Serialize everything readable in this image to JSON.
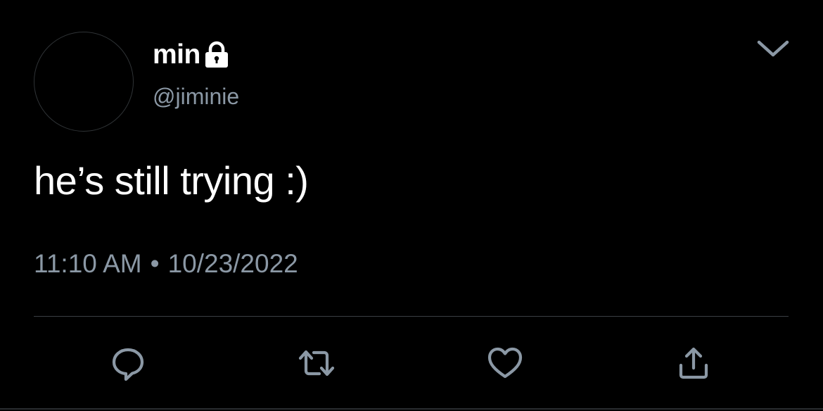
{
  "tweet": {
    "display_name": "min",
    "handle": "@jiminie",
    "text": "he’s still trying :)",
    "time": "11:10 AM",
    "separator": "•",
    "date": "10/23/2022"
  },
  "icons": {
    "lock": "lock-icon",
    "caret": "chevron-down-icon",
    "reply": "reply-icon",
    "retweet": "retweet-icon",
    "like": "heart-icon",
    "share": "share-icon"
  },
  "colors": {
    "background": "#000000",
    "primary_text": "#ffffff",
    "secondary_text": "#8b98a5",
    "divider": "#3a3f44"
  }
}
